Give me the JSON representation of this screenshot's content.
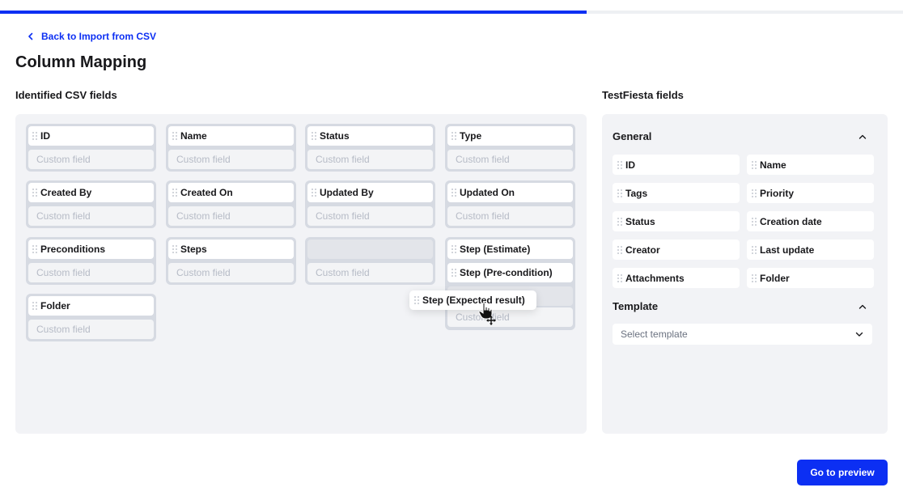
{
  "progress": {
    "fraction": 0.65,
    "accent": "#0c2ff3"
  },
  "nav": {
    "back_label": "Back to Import from CSV"
  },
  "page": {
    "title": "Column Mapping"
  },
  "left": {
    "heading": "Identified CSV fields",
    "placeholder": "Custom field",
    "cards": [
      {
        "label": "ID"
      },
      {
        "label": "Name"
      },
      {
        "label": "Status"
      },
      {
        "label": "Type"
      },
      {
        "label": "Created By"
      },
      {
        "label": "Created On"
      },
      {
        "label": "Updated By"
      },
      {
        "label": "Updated On"
      },
      {
        "label": "Preconditions"
      },
      {
        "label": "Steps"
      },
      {
        "label": ""
      },
      {
        "label": "Step (Estimate)",
        "label2": "Step (Pre-condition)"
      },
      {
        "label": "Folder"
      }
    ],
    "dragging": "Step (Expected result)"
  },
  "right": {
    "heading": "TestFiesta fields",
    "general": {
      "title": "General",
      "fields": [
        "ID",
        "Name",
        "Tags",
        "Priority",
        "Status",
        "Creation date",
        "Creator",
        "Last update",
        "Attachments",
        "Folder"
      ]
    },
    "template": {
      "title": "Template",
      "select_placeholder": "Select template"
    }
  },
  "footer": {
    "primary_label": "Go to preview"
  },
  "icons": [
    "chevron-left-icon",
    "drag-grip-icon",
    "chevron-up-icon",
    "chevron-down-icon",
    "hand-cursor-icon",
    "move-cursor-icon"
  ]
}
